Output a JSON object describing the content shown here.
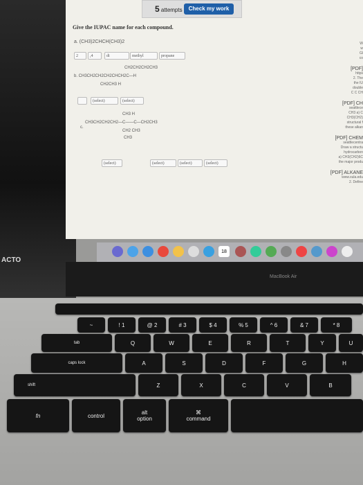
{
  "header": {
    "attempts_count": "5",
    "attempts_label": "attempts left",
    "check_button": "Check my work"
  },
  "question": {
    "instruction": "Give the IUPAC name for each compound.",
    "a": {
      "formula": "a. (CH3)2CHCH(CH3)2",
      "locant1": "2",
      "locant2": ",4",
      "prefix": "di",
      "substituent": "methyl",
      "parent": "propane"
    },
    "b": {
      "line1": "CH2CH2CH2CH3",
      "line2": "b. CH3CH2CH2CH2CHCH2C—H",
      "line3": "CH2CH3   H",
      "select1": "(select)",
      "select2": "(select)"
    },
    "c": {
      "line1": "CH3  H",
      "line2": "CH3CH2CH2CH2—C——C—CH2CH3",
      "label": "c.",
      "line3": "CH2 CH3",
      "line4": "CH3",
      "selects": [
        "(select)",
        "(select)",
        "(select)",
        "(select)"
      ]
    }
  },
  "sidebar_results": [
    {
      "lines": [
        "W",
        "w",
        "Gl",
        "co"
      ]
    },
    {
      "title": "[PDF]",
      "lines": [
        "https",
        "2. The",
        "the IU",
        "double",
        "C C CH"
      ]
    },
    {
      "title": "[PDF] CH",
      "lines": [
        "seattlece",
        "CH3 a) C",
        "CH3(CH2)",
        "structural f",
        "these alkan"
      ]
    },
    {
      "title": "[PDF] CHEM",
      "lines": [
        "seattlecentra",
        "Draw a structu",
        "hydrocarbon",
        "a) CH3(CH2)6C",
        "the major produ"
      ]
    },
    {
      "title": "[PDF] ALKANE",
      "lines": [
        "www.xula.edu",
        "2. Define"
      ]
    }
  ],
  "dock": {
    "calendar_day": "18"
  },
  "laptop": {
    "brand": "MacBook Air",
    "sticker": "ACTO"
  },
  "keyboard": {
    "row1": [
      "~",
      "!\n1",
      "@\n2",
      "#\n3",
      "$\n4",
      "%\n5",
      "^\n6",
      "&\n7",
      "*\n8"
    ],
    "row2": [
      "tab",
      "Q",
      "W",
      "E",
      "R",
      "T",
      "Y",
      "U"
    ],
    "row3": [
      "caps lock",
      "A",
      "S",
      "D",
      "F",
      "G",
      "H"
    ],
    "row4": [
      "shift",
      "Z",
      "X",
      "C",
      "V",
      "B"
    ],
    "row5": [
      "fn",
      "control",
      "alt\noption",
      "⌘\ncommand"
    ]
  }
}
